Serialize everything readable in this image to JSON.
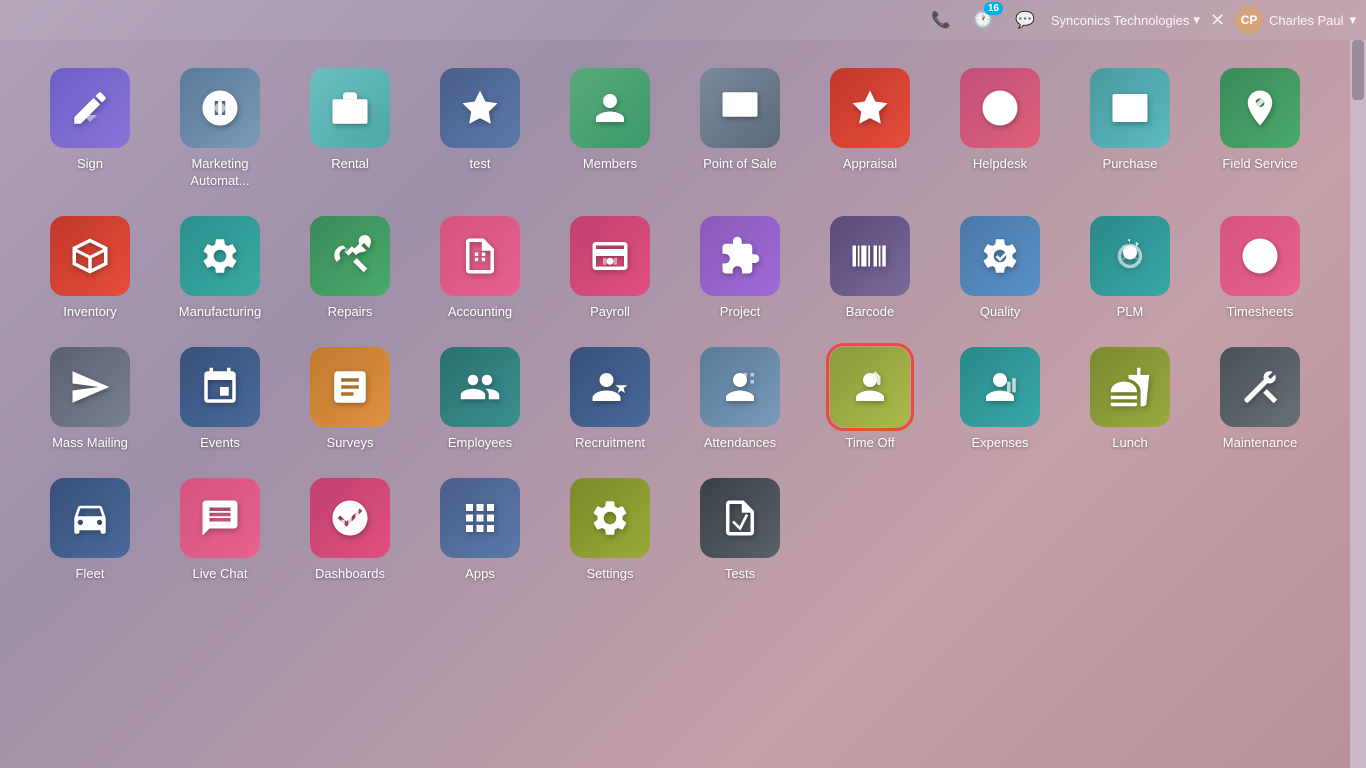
{
  "topbar": {
    "phone_icon": "📞",
    "activity_icon": "🕐",
    "activity_count": "16",
    "chat_icon": "💬",
    "company": "Synconics Technologies",
    "user": "Charles Paul"
  },
  "apps": [
    {
      "id": "sign",
      "label": "Sign",
      "color": "ic-purple",
      "icon": "sign"
    },
    {
      "id": "marketing",
      "label": "Marketing Automat...",
      "color": "ic-blue-gray",
      "icon": "marketing"
    },
    {
      "id": "rental",
      "label": "Rental",
      "color": "ic-teal",
      "icon": "rental"
    },
    {
      "id": "test",
      "label": "test",
      "color": "ic-navy",
      "icon": "test"
    },
    {
      "id": "members",
      "label": "Members",
      "color": "ic-green",
      "icon": "members"
    },
    {
      "id": "point-of-sale",
      "label": "Point of Sale",
      "color": "ic-dark-gray",
      "icon": "pos"
    },
    {
      "id": "appraisal",
      "label": "Appraisal",
      "color": "ic-red",
      "icon": "appraisal"
    },
    {
      "id": "helpdesk",
      "label": "Helpdesk",
      "color": "ic-pink",
      "icon": "helpdesk"
    },
    {
      "id": "purchase",
      "label": "Purchase",
      "color": "ic-teal2",
      "icon": "purchase"
    },
    {
      "id": "field-service",
      "label": "Field Service",
      "color": "ic-green2",
      "icon": "fieldservice"
    },
    {
      "id": "inventory",
      "label": "Inventory",
      "color": "ic-red",
      "icon": "inventory"
    },
    {
      "id": "manufacturing",
      "label": "Manufacturing",
      "color": "ic-teal3",
      "icon": "manufacturing"
    },
    {
      "id": "repairs",
      "label": "Repairs",
      "color": "ic-green2",
      "icon": "repairs"
    },
    {
      "id": "accounting",
      "label": "Accounting",
      "color": "ic-pink2",
      "icon": "accounting"
    },
    {
      "id": "payroll",
      "label": "Payroll",
      "color": "ic-pink3",
      "icon": "payroll"
    },
    {
      "id": "project",
      "label": "Project",
      "color": "ic-purple2",
      "icon": "project"
    },
    {
      "id": "barcode",
      "label": "Barcode",
      "color": "ic-dark-purple",
      "icon": "barcode"
    },
    {
      "id": "quality",
      "label": "Quality",
      "color": "ic-blue2",
      "icon": "quality"
    },
    {
      "id": "plm",
      "label": "PLM",
      "color": "ic-teal4",
      "icon": "plm"
    },
    {
      "id": "timesheets",
      "label": "Timesheets",
      "color": "ic-pink2",
      "icon": "timesheets"
    },
    {
      "id": "mass-mailing",
      "label": "Mass Mailing",
      "color": "ic-dark-slate",
      "icon": "massmailing"
    },
    {
      "id": "events",
      "label": "Events",
      "color": "ic-navy2",
      "icon": "events"
    },
    {
      "id": "surveys",
      "label": "Surveys",
      "color": "ic-orange",
      "icon": "surveys"
    },
    {
      "id": "employees",
      "label": "Employees",
      "color": "ic-dark-teal",
      "icon": "employees"
    },
    {
      "id": "recruitment",
      "label": "Recruitment",
      "color": "ic-navy2",
      "icon": "recruitment"
    },
    {
      "id": "attendances",
      "label": "Attendances",
      "color": "ic-blue-gray",
      "icon": "attendances"
    },
    {
      "id": "time-off",
      "label": "Time Off",
      "color": "ic-olive",
      "icon": "timeoff",
      "selected": true
    },
    {
      "id": "expenses",
      "label": "Expenses",
      "color": "ic-teal4",
      "icon": "expenses"
    },
    {
      "id": "lunch",
      "label": "Lunch",
      "color": "ic-olive2",
      "icon": "lunch"
    },
    {
      "id": "maintenance",
      "label": "Maintenance",
      "color": "ic-dark2",
      "icon": "maintenance"
    },
    {
      "id": "fleet",
      "label": "Fleet",
      "color": "ic-navy2",
      "icon": "fleet"
    },
    {
      "id": "live-chat",
      "label": "Live Chat",
      "color": "ic-pink2",
      "icon": "livechat"
    },
    {
      "id": "dashboards",
      "label": "Dashboards",
      "color": "ic-pink3",
      "icon": "dashboards"
    },
    {
      "id": "apps",
      "label": "Apps",
      "color": "ic-navy",
      "icon": "apps"
    },
    {
      "id": "settings",
      "label": "Settings",
      "color": "ic-olive3",
      "icon": "settings"
    },
    {
      "id": "tests",
      "label": "Tests",
      "color": "ic-dark3",
      "icon": "tests"
    }
  ]
}
